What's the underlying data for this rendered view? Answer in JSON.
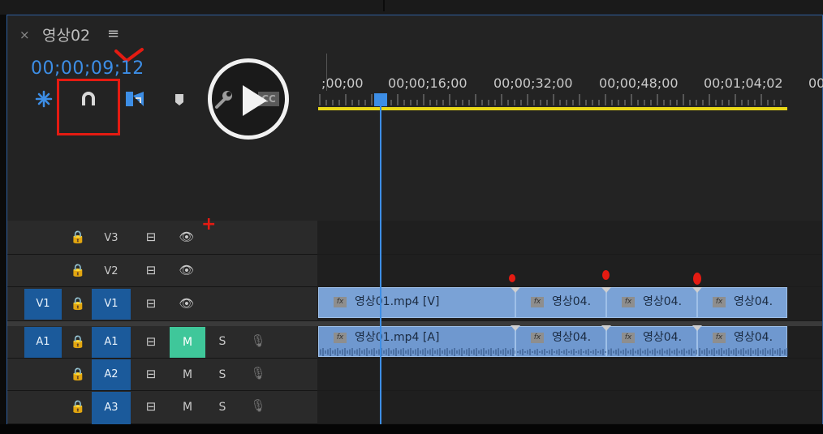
{
  "panel": {
    "close_glyph": "×",
    "title": "영상02",
    "menu_glyph": "≡",
    "timecode": "00;00;09;12"
  },
  "toolbar": {
    "icons": [
      "snap-nested-icon",
      "magnet-snap-icon",
      "linked-selection-icon",
      "add-marker-icon",
      "wrench-settings-icon",
      "captions-icon"
    ],
    "captions_label": "CC"
  },
  "overlay": {
    "play_button": "play-icon"
  },
  "ruler": {
    "labels": [
      ";00;00",
      "00;00;16;00",
      "00;00;32;00",
      "00;00;48;00",
      "00;01;04;02",
      "00"
    ]
  },
  "tracks": {
    "video": [
      {
        "source": "",
        "lock": "🔒",
        "name": "V3",
        "sync": "⊟",
        "eye": "👁"
      },
      {
        "source": "",
        "lock": "🔒",
        "name": "V2",
        "sync": "⊟",
        "eye": "👁"
      },
      {
        "source": "V1",
        "lock": "🔒",
        "name": "V1",
        "sync": "⊟",
        "eye": "👁"
      }
    ],
    "audio": [
      {
        "source": "A1",
        "lock": "🔒",
        "name": "A1",
        "sync": "⊟",
        "m": "M",
        "s": "S",
        "mic": "🎙",
        "m_active": true
      },
      {
        "source": "",
        "lock": "🔒",
        "name": "A2",
        "sync": "⊟",
        "m": "M",
        "s": "S",
        "mic": "🎙",
        "m_active": false
      },
      {
        "source": "",
        "lock": "🔒",
        "name": "A3",
        "sync": "⊟",
        "m": "M",
        "s": "S",
        "mic": "🎙",
        "m_active": false
      }
    ]
  },
  "clips": {
    "video": [
      "영상01.mp4 [V]",
      "영상04.",
      "영상04.",
      "영상04."
    ],
    "audio": [
      "영상01.mp4 [A]",
      "영상04.",
      "영상04.",
      "영상04."
    ],
    "fx_label": "fx"
  },
  "annotations": {
    "plus_mark": "+",
    "colors": {
      "accent": "#3d8ee6",
      "red": "#e41b12",
      "clip": "#7aa2d6",
      "mute_on": "#3fc79a",
      "work_area": "#e8d718"
    }
  }
}
